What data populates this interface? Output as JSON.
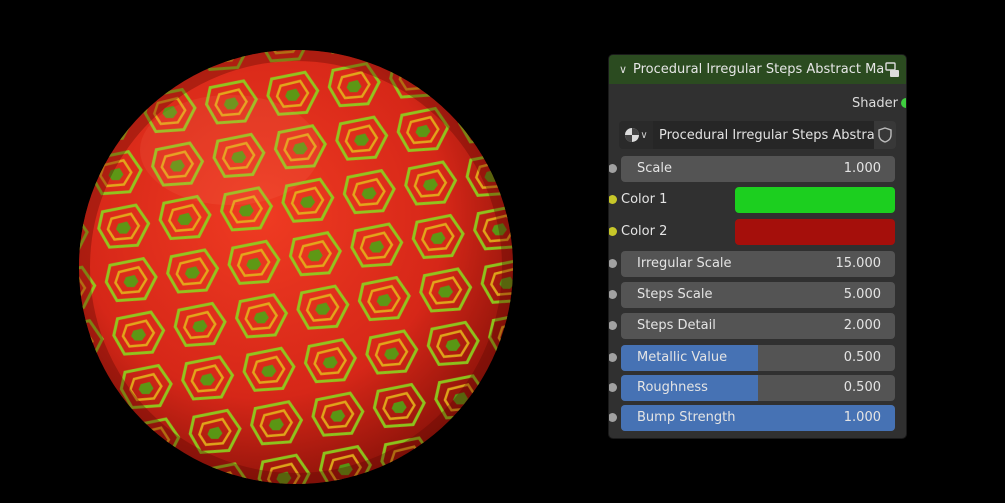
{
  "node": {
    "title": "Procedural Irregular Steps Abstract Material",
    "output_label": "Shader",
    "material_name": "Procedural Irregular Steps Abstract ...",
    "inputs": [
      {
        "label": "Scale",
        "value": "1.000",
        "fill": 0
      },
      {
        "label": "Color 1",
        "color": "#1ccf1f"
      },
      {
        "label": "Color 2",
        "color": "#a50f0b"
      },
      {
        "label": "Irregular Scale",
        "value": "15.000",
        "fill": 0
      },
      {
        "label": "Steps Scale",
        "value": "5.000",
        "fill": 0
      },
      {
        "label": "Steps Detail",
        "value": "2.000",
        "fill": 0
      },
      {
        "label": "Metallic Value",
        "value": "0.500",
        "fill": 0.5
      },
      {
        "label": "Roughness",
        "value": "0.500",
        "fill": 0.5
      },
      {
        "label": "Bump Strength",
        "value": "1.000",
        "fill": 1.0
      }
    ]
  },
  "colors": {
    "header": "#2b4b20",
    "shader_socket": "#3fce3f",
    "float_socket": "#a1a1a1",
    "color_socket": "#c7c729",
    "slider_fill": "#4672b4"
  }
}
